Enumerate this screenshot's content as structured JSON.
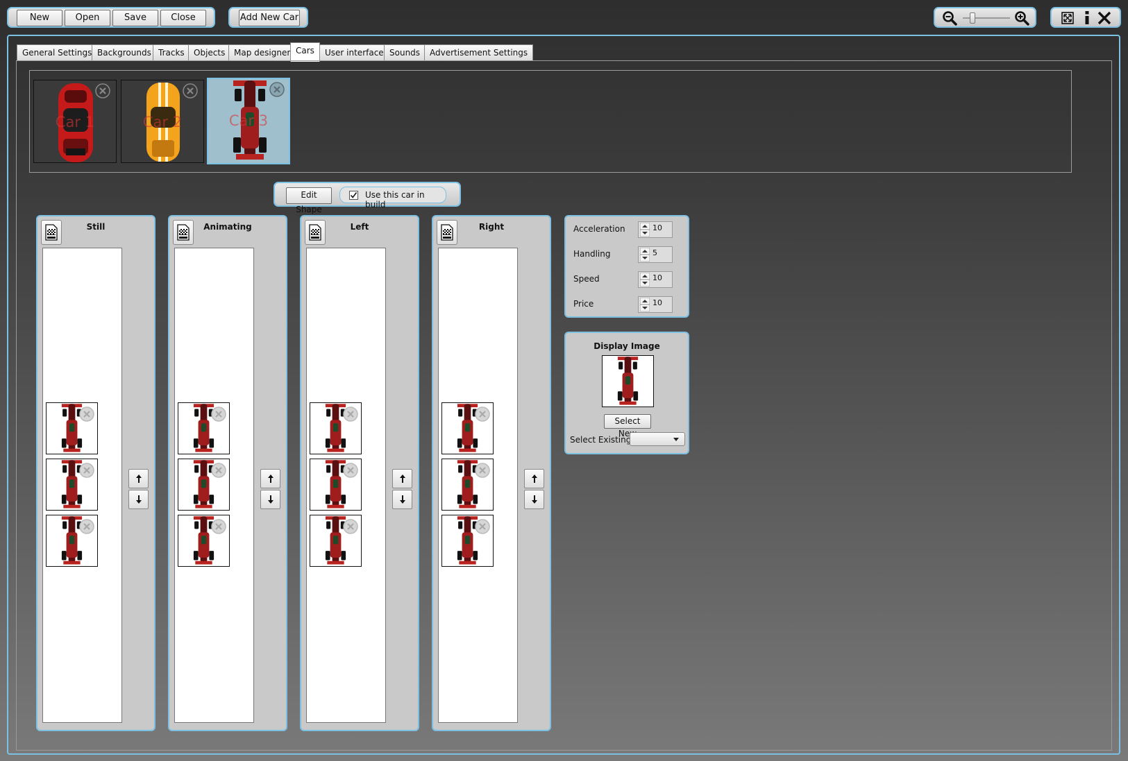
{
  "toolbar": {
    "new_label": "New",
    "open_label": "Open",
    "save_label": "Save",
    "close_label": "Close",
    "add_car_label": "Add New Car"
  },
  "zoom": {
    "level": 0.15
  },
  "icons": {
    "zoom_out": "zoom-out-icon",
    "zoom_in": "zoom-in-icon",
    "fullscreen": "fullscreen-icon",
    "info": "info-icon",
    "close": "close-icon"
  },
  "tabs": [
    {
      "label": "General Settings"
    },
    {
      "label": "Backgrounds"
    },
    {
      "label": "Tracks"
    },
    {
      "label": "Objects"
    },
    {
      "label": "Map designer"
    },
    {
      "label": "Cars"
    },
    {
      "label": "User interface"
    },
    {
      "label": "Sounds"
    },
    {
      "label": "Advertisement Settings"
    }
  ],
  "active_tab": "Cars",
  "cars": [
    {
      "label": "Car 1",
      "color": "#c41a1a"
    },
    {
      "label": "Car 2",
      "color": "#f4a31c"
    },
    {
      "label": "Car 3",
      "color": "#a01d1d"
    }
  ],
  "car_options": {
    "edit_shape_label": "Edit Shape",
    "use_in_build_label": "Use this car in build",
    "use_in_build_checked": true
  },
  "frame_panels": [
    {
      "title": "Still"
    },
    {
      "title": "Animating"
    },
    {
      "title": "Left"
    },
    {
      "title": "Right"
    }
  ],
  "stats": [
    {
      "label": "Acceleration",
      "value": "10"
    },
    {
      "label": "Handling",
      "value": "5"
    },
    {
      "label": "Speed",
      "value": "10"
    },
    {
      "label": "Price",
      "value": "10"
    }
  ],
  "display_image": {
    "title": "Display Image",
    "select_new_label": "Select New",
    "select_existing_label": "Select Existing",
    "select_existing_value": ""
  },
  "colors": {
    "accent": "#7cc0e4",
    "panel_bg": "#c9c9c9",
    "selected_car_bg": "#9fbfcd"
  }
}
